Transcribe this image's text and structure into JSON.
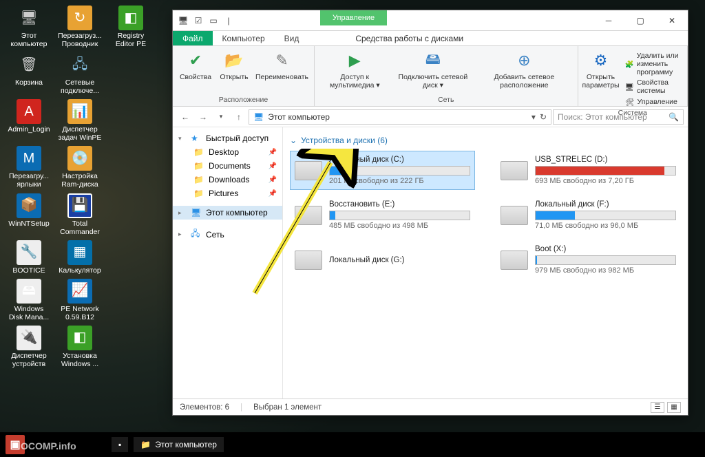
{
  "desktop_icons": [
    {
      "label": "Этот компьютер",
      "ic": "🖥",
      "cls": "i-pc"
    },
    {
      "label": "Перезагруз... Проводник",
      "ic": "↻",
      "cls": "i-yel"
    },
    {
      "label": "Registry Editor PE",
      "ic": "◧",
      "cls": "i-grn"
    },
    {
      "label": "Корзина",
      "ic": "🗑",
      "cls": "i-bin"
    },
    {
      "label": "Сетевые подключе...",
      "ic": "🖧",
      "cls": "i-net"
    },
    {
      "label": "",
      "ic": "",
      "cls": ""
    },
    {
      "label": "Admin_Login",
      "ic": "A",
      "cls": "i-aa"
    },
    {
      "label": "Диспетчер задач WinPE",
      "ic": "📊",
      "cls": "i-yel"
    },
    {
      "label": "",
      "ic": "",
      "cls": ""
    },
    {
      "label": "Перезагру... ярлыки",
      "ic": "M",
      "cls": "i-m"
    },
    {
      "label": "Настройка Ram-диска",
      "ic": "💿",
      "cls": "i-yel"
    },
    {
      "label": "",
      "ic": "",
      "cls": ""
    },
    {
      "label": "WinNTSetup",
      "ic": "📦",
      "cls": "i-dk"
    },
    {
      "label": "Total Commander",
      "ic": "💾",
      "cls": "i-tc"
    },
    {
      "label": "",
      "ic": "",
      "cls": ""
    },
    {
      "label": "BOOTICE",
      "ic": "🔧",
      "cls": "i-wh"
    },
    {
      "label": "Калькулятор",
      "ic": "▦",
      "cls": "i-cl"
    },
    {
      "label": "",
      "ic": "",
      "cls": ""
    },
    {
      "label": "Windows Disk Mana...",
      "ic": "🖴",
      "cls": "i-wh"
    },
    {
      "label": "PE Network 0.59.B12",
      "ic": "📈",
      "cls": "i-dk"
    },
    {
      "label": "",
      "ic": "",
      "cls": ""
    },
    {
      "label": "Диспетчер устройств",
      "ic": "🔌",
      "cls": "i-wh"
    },
    {
      "label": "Установка Windows ...",
      "ic": "◧",
      "cls": "i-grn"
    }
  ],
  "window": {
    "title": "Этот компьютер",
    "manage": "Управление",
    "tool_caption": "Средства работы с дисками",
    "tabs": {
      "file": "Файл",
      "computer": "Компьютер",
      "view": "Вид"
    },
    "ribbon": {
      "group1": {
        "props": "Свойства",
        "open": "Открыть",
        "rename": "Переименовать",
        "label": "Расположение"
      },
      "group2": {
        "media": "Доступ к мультимедиа ▾",
        "map": "Подключить сетевой диск ▾",
        "addnet": "Добавить сетевое расположение",
        "label": "Сеть"
      },
      "group3": {
        "settings": "Открыть параметры",
        "u1": "Удалить или изменить программу",
        "u2": "Свойства системы",
        "u3": "Управление",
        "label": "Система"
      }
    },
    "addr": {
      "location": "Этот компьютер",
      "search_ph": "Поиск: Этот компьютер"
    },
    "side": {
      "quick": "Быстрый доступ",
      "items": [
        {
          "label": "Desktop",
          "pin": true
        },
        {
          "label": "Documents",
          "pin": true
        },
        {
          "label": "Downloads",
          "pin": true
        },
        {
          "label": "Pictures",
          "pin": true
        }
      ],
      "pc": "Этот компьютер",
      "net": "Сеть"
    },
    "section": "Устройства и диски (6)",
    "drives": [
      {
        "name": "Локальный диск (C:)",
        "free": "201 ГБ свободно из 222 ГБ",
        "pct": 10,
        "sel": true
      },
      {
        "name": "USB_STRELEC (D:)",
        "free": "693 МБ свободно из 7,20 ГБ",
        "pct": 92,
        "red": true
      },
      {
        "name": "Восстановить (E:)",
        "free": "485 МБ свободно из 498 МБ",
        "pct": 4
      },
      {
        "name": "Локальный диск (F:)",
        "free": "71,0 МБ свободно из 96,0 МБ",
        "pct": 28
      },
      {
        "name": "Локальный диск (G:)",
        "free": "",
        "pct": null
      },
      {
        "name": "Boot (X:)",
        "free": "979 МБ свободно из 982 МБ",
        "pct": 1
      }
    ],
    "status": {
      "items": "Элементов: 6",
      "selected": "Выбран 1 элемент"
    }
  },
  "taskbar": {
    "app": "Этот компьютер",
    "watermark": "OCOMP.info"
  }
}
